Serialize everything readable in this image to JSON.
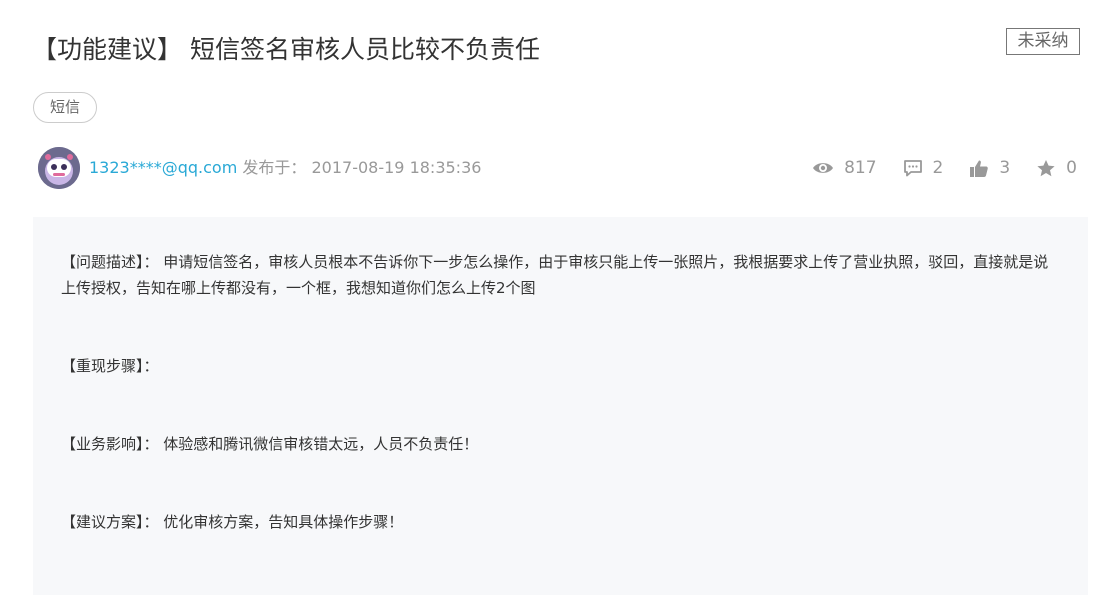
{
  "post": {
    "title": "【功能建议】 短信签名审核人员比较不负责任",
    "status": "未采纳",
    "tag": "短信"
  },
  "author": {
    "name": "1323****@qq.com",
    "publish_label": "发布于：",
    "publish_time": "2017-08-19 18:35:36"
  },
  "stats": {
    "views": "817",
    "comments": "2",
    "likes": "3",
    "favorites": "0"
  },
  "content": {
    "description": "【问题描述】：  申请短信签名，审核人员根本不告诉你下一步怎么操作，由于审核只能上传一张照片，我根据要求上传了营业执照，驳回，直接就是说上传授权，告知在哪上传都没有，一个框，我想知道你们怎么上传2个图",
    "steps": "【重现步骤】：",
    "impact": "【业务影响】：  体验感和腾讯微信审核错太远，人员不负责任！",
    "solution": "【建议方案】：  优化审核方案，告知具体操作步骤！"
  },
  "colors": {
    "accent": "#2aa9d6",
    "muted": "#999999",
    "content_bg": "#f7f8fa"
  },
  "icons": [
    "eye-icon",
    "comment-icon",
    "thumbs-up-icon",
    "star-icon"
  ]
}
